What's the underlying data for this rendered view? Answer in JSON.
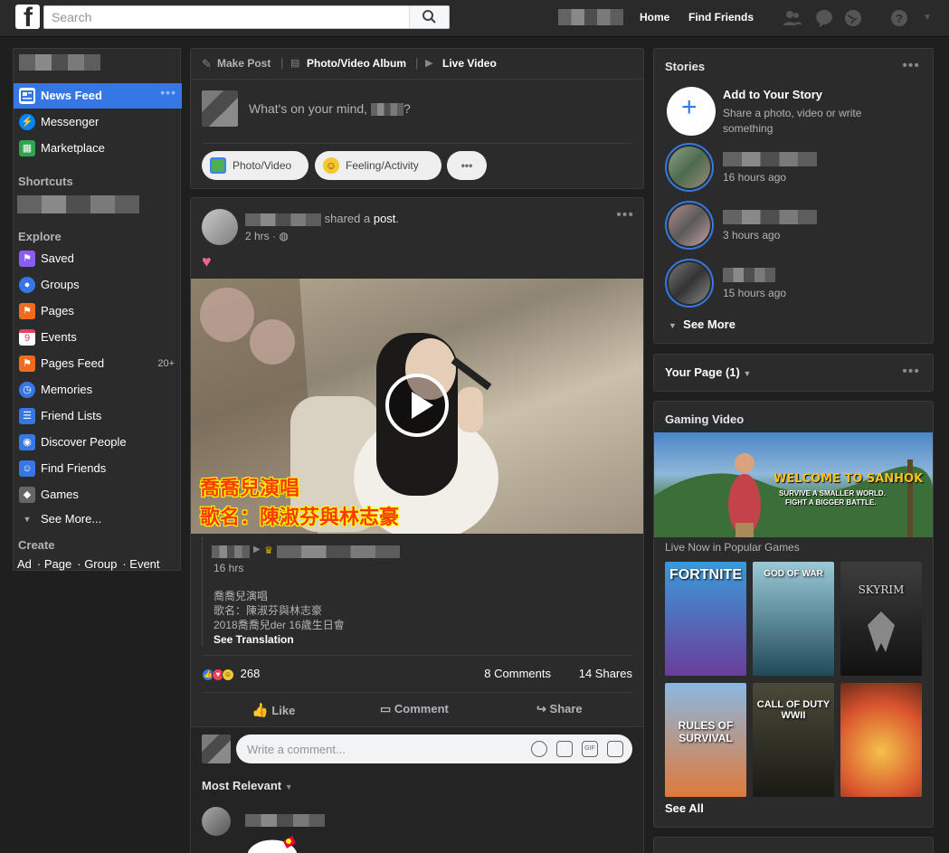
{
  "topbar": {
    "logo": "f",
    "search_placeholder": "Search",
    "home": "Home",
    "find_friends": "Find Friends"
  },
  "leftnav": {
    "items": [
      {
        "label": "News Feed",
        "icon": "news-feed-icon",
        "color": "#3578e5"
      },
      {
        "label": "Messenger",
        "icon": "messenger-icon",
        "color": "#0084ff"
      },
      {
        "label": "Marketplace",
        "icon": "marketplace-icon",
        "color": "#2ea44f"
      }
    ],
    "shortcuts_heading": "Shortcuts",
    "explore_heading": "Explore",
    "explore": [
      {
        "label": "Saved",
        "icon": "saved-icon",
        "color": "#8b5cf6"
      },
      {
        "label": "Groups",
        "icon": "groups-icon",
        "color": "#3578e5"
      },
      {
        "label": "Pages",
        "icon": "pages-icon",
        "color": "#f26b1d"
      },
      {
        "label": "Events",
        "icon": "events-icon",
        "color": "#e4405f"
      },
      {
        "label": "Pages Feed",
        "icon": "pages-feed-icon",
        "color": "#f26b1d",
        "badge": "20+"
      },
      {
        "label": "Memories",
        "icon": "memories-icon",
        "color": "#3578e5"
      },
      {
        "label": "Friend Lists",
        "icon": "friend-lists-icon",
        "color": "#3578e5"
      },
      {
        "label": "Discover People",
        "icon": "discover-people-icon",
        "color": "#3578e5"
      },
      {
        "label": "Find Friends",
        "icon": "find-friends-icon",
        "color": "#3578e5"
      },
      {
        "label": "Games",
        "icon": "games-icon",
        "color": "#888"
      },
      {
        "label": "See More...",
        "icon": "chevron-down-icon",
        "color": "transparent"
      }
    ],
    "create_heading": "Create",
    "create_links": [
      "Ad",
      "Page",
      "Group",
      "Event"
    ]
  },
  "composer": {
    "tab_make_post": "Make Post",
    "tab_album": "Photo/Video Album",
    "tab_live": "Live Video",
    "prompt": "What's on your mind,",
    "prompt_end": "?",
    "btn_photo": "Photo/Video",
    "btn_feeling": "Feeling/Activity",
    "btn_more": "•••"
  },
  "post": {
    "shared_text": "shared a",
    "shared_link": "post",
    "time": "2 hrs",
    "video_sub1": "喬喬兒演唱",
    "video_sub2": "歌名：陳淑芬與林志豪",
    "inner_time": "16 hrs",
    "text_lines": [
      "喬喬兒演唱",
      "歌名：陳淑芬與林志豪",
      "2018喬喬兒der 16歲生日會"
    ],
    "see_translation": "See Translation",
    "reactions": "268",
    "comments": "8 Comments",
    "shares": "14 Shares",
    "like": "Like",
    "comment": "Comment",
    "share": "Share",
    "comment_placeholder": "Write a comment...",
    "sort": "Most Relevant"
  },
  "stories": {
    "title": "Stories",
    "add_title": "Add to Your Story",
    "add_sub": "Share a photo, video or write something",
    "items": [
      {
        "time": "16 hours ago"
      },
      {
        "time": "3 hours ago"
      },
      {
        "time": "15 hours ago"
      }
    ],
    "see_more": "See More"
  },
  "your_page": {
    "title": "Your Page (1)"
  },
  "gaming": {
    "title": "Gaming Video",
    "banner_title": "WELCOME TO SANHOK",
    "banner_sub1": "SURVIVE A SMALLER WORLD.",
    "banner_sub2": "FIGHT A BIGGER BATTLE.",
    "live_now": "Live Now in Popular Games",
    "games": [
      "FORTNITE",
      "GOD OF WAR",
      "SKYRIM",
      "RULES OF SURVIVAL",
      "CALL OF DUTY WWII",
      ""
    ],
    "see_all": "See All"
  }
}
